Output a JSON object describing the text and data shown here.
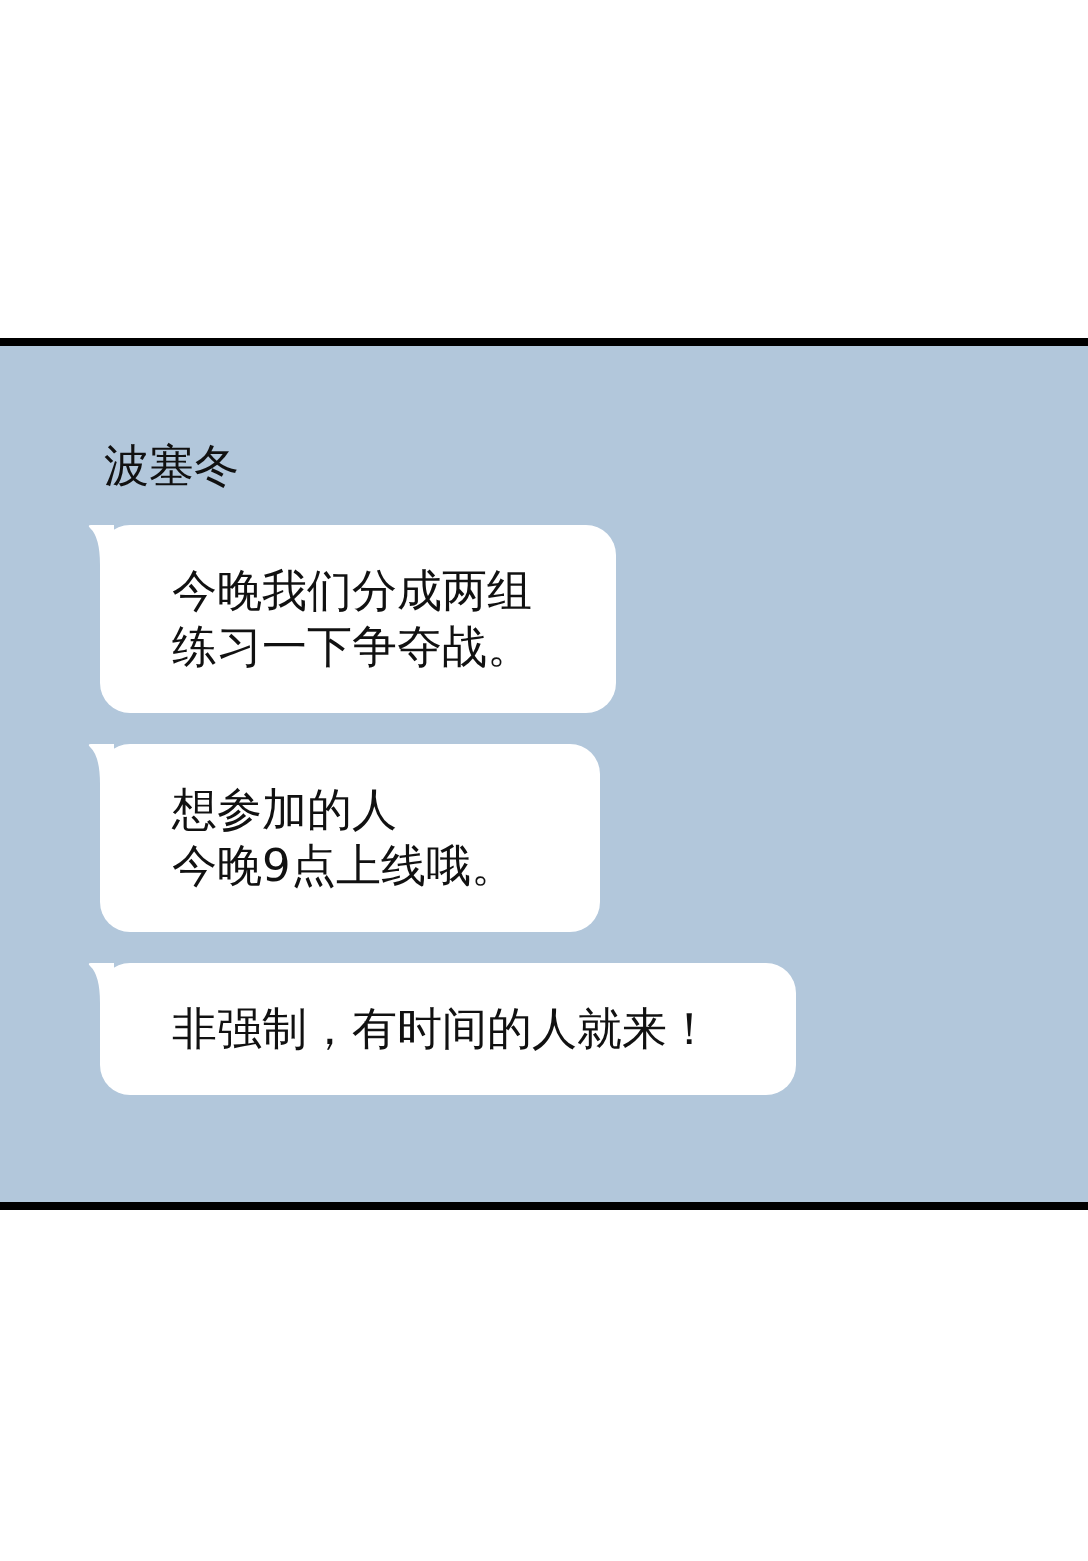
{
  "chat": {
    "sender": "波塞冬",
    "messages": [
      {
        "lines": [
          "今晚我们分成两组",
          "练习一下争夺战。"
        ]
      },
      {
        "lines": [
          "想参加的人",
          "今晚9点上线哦。"
        ]
      },
      {
        "lines": [
          "非强制，有时间的人就来！"
        ]
      }
    ]
  }
}
